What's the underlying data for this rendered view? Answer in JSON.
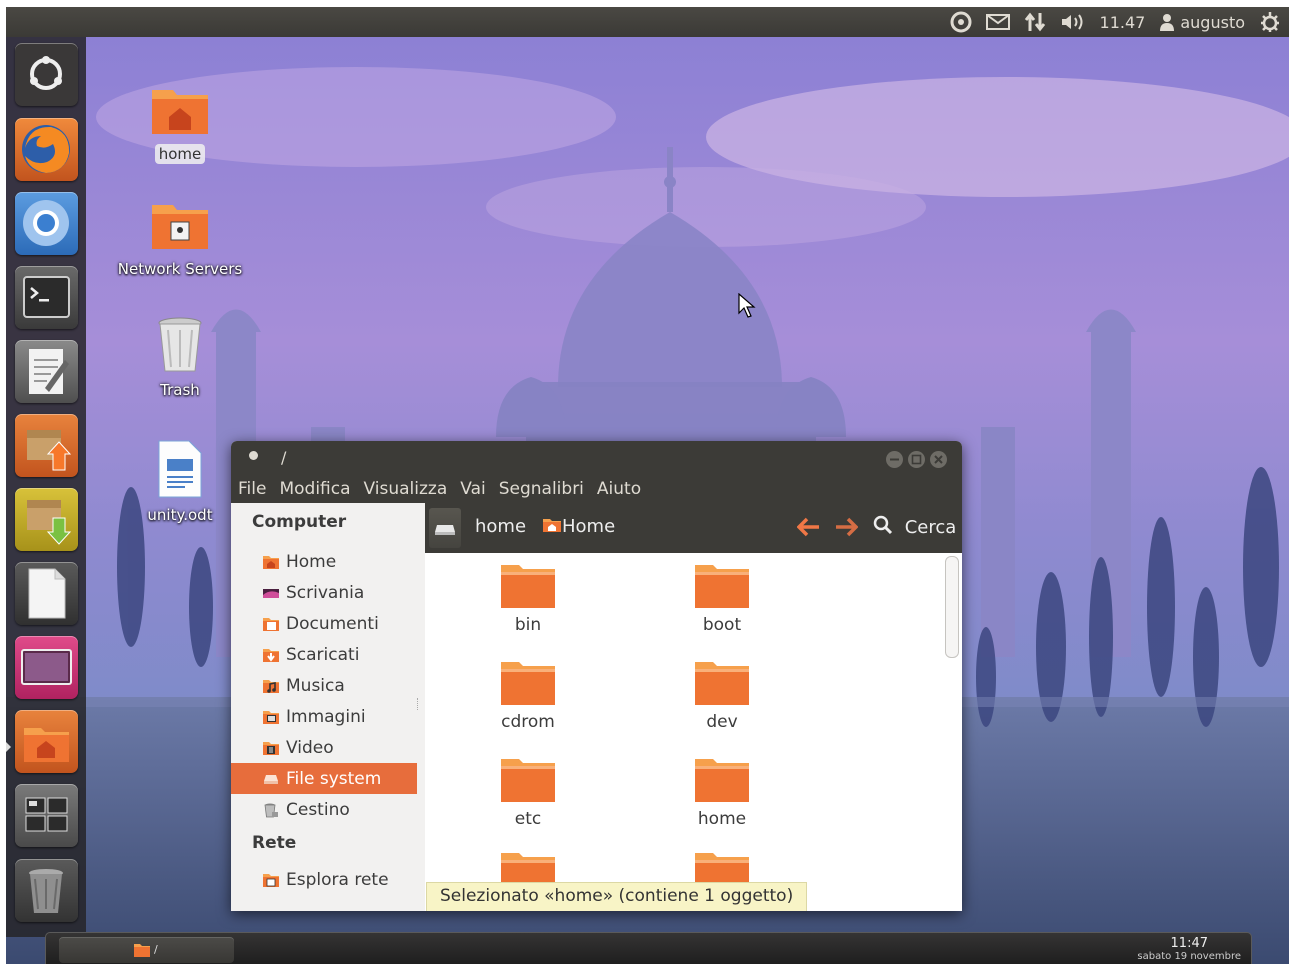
{
  "top_panel": {
    "time": "11.47",
    "user": "augusto",
    "indicators": [
      "ubuntu-one-icon",
      "mail-icon",
      "network-icon",
      "volume-icon",
      "user-icon",
      "gear-icon"
    ]
  },
  "launcher": {
    "items": [
      "dash-home",
      "firefox",
      "chromium",
      "terminal",
      "text-editor",
      "file-archiver-upload",
      "file-archiver-download",
      "libreoffice",
      "image-viewer",
      "home-folder",
      "workspace-switcher",
      "trash"
    ]
  },
  "desktop": {
    "icons": [
      {
        "label": "home"
      },
      {
        "label": "Network Servers"
      },
      {
        "label": "Trash"
      },
      {
        "label": "unity.odt"
      }
    ]
  },
  "window": {
    "title": "/",
    "menu": [
      "File",
      "Modifica",
      "Visualizza",
      "Vai",
      "Segnalibri",
      "Aiuto"
    ],
    "toolbar": {
      "breadcrumb_root": "home",
      "breadcrumb_current": "Home",
      "search": "Cerca"
    },
    "sidebar": {
      "computer_header": "Computer",
      "computer_items": [
        {
          "label": "Home",
          "icon": "home-folder-icon"
        },
        {
          "label": "Scrivania",
          "icon": "desktop-icon"
        },
        {
          "label": "Documenti",
          "icon": "documents-icon"
        },
        {
          "label": "Scaricati",
          "icon": "downloads-icon"
        },
        {
          "label": "Musica",
          "icon": "music-icon"
        },
        {
          "label": "Immagini",
          "icon": "pictures-icon"
        },
        {
          "label": "Video",
          "icon": "video-icon"
        },
        {
          "label": "File system",
          "icon": "harddisk-icon",
          "active": true
        },
        {
          "label": "Cestino",
          "icon": "trash-icon"
        }
      ],
      "network_header": "Rete",
      "network_items": [
        {
          "label": "Esplora rete",
          "icon": "network-folder-icon"
        }
      ]
    },
    "files": [
      {
        "name": "bin"
      },
      {
        "name": "boot"
      },
      {
        "name": "cdrom"
      },
      {
        "name": "dev"
      },
      {
        "name": "etc"
      },
      {
        "name": "home"
      },
      {
        "name": ""
      },
      {
        "name": ""
      }
    ],
    "status": "Selezionato «home» (contiene 1 oggetto)"
  },
  "bottom_panel": {
    "task_label": "/",
    "clock_time": "11:47",
    "clock_date": "sabato 19 novembre"
  },
  "colors": {
    "accent": "#e76d3c",
    "panel": "#3c3b37",
    "folder": "#f07746"
  }
}
